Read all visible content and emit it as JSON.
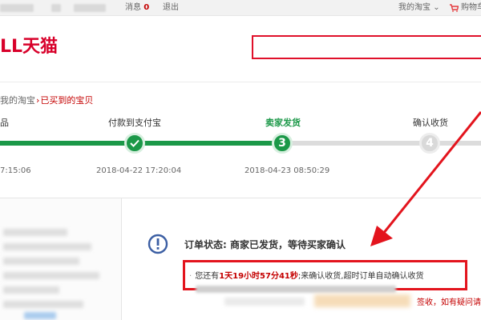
{
  "topbar": {
    "message_label": "消息",
    "message_count": "0",
    "logout_label": "退出",
    "my_taobao_label": "我的淘宝",
    "my_taobao_caret": "⌄",
    "cart_label": "购物车"
  },
  "header": {
    "logo_text": "LL天猫"
  },
  "breadcrumb": {
    "parent": "我的淘宝",
    "separator": "›",
    "current": "已买到的宝贝"
  },
  "progress": {
    "steps": [
      {
        "label": "品",
        "state": "done",
        "time": "7:15:06"
      },
      {
        "label": "付款到支付宝",
        "state": "done",
        "time": "2018-04-22 17:20:04"
      },
      {
        "label": "卖家发货",
        "state": "current",
        "number": "3",
        "time": "2018-04-23 08:50:29"
      },
      {
        "label": "确认收货",
        "state": "todo",
        "number": "4",
        "time": ""
      }
    ]
  },
  "order": {
    "status_text": "订单状态: 商家已发货，等待买家确认",
    "notice_prefix": "您还有",
    "notice_time": "1天19小时57分41秒",
    "notice_suffix": ";来确认收货,超时订单自动确认收货",
    "help_text": "签收，如有疑问请"
  },
  "colors": {
    "brand_red": "#d8002a",
    "progress_green": "#1b9848",
    "highlight_red": "#e3141d"
  }
}
